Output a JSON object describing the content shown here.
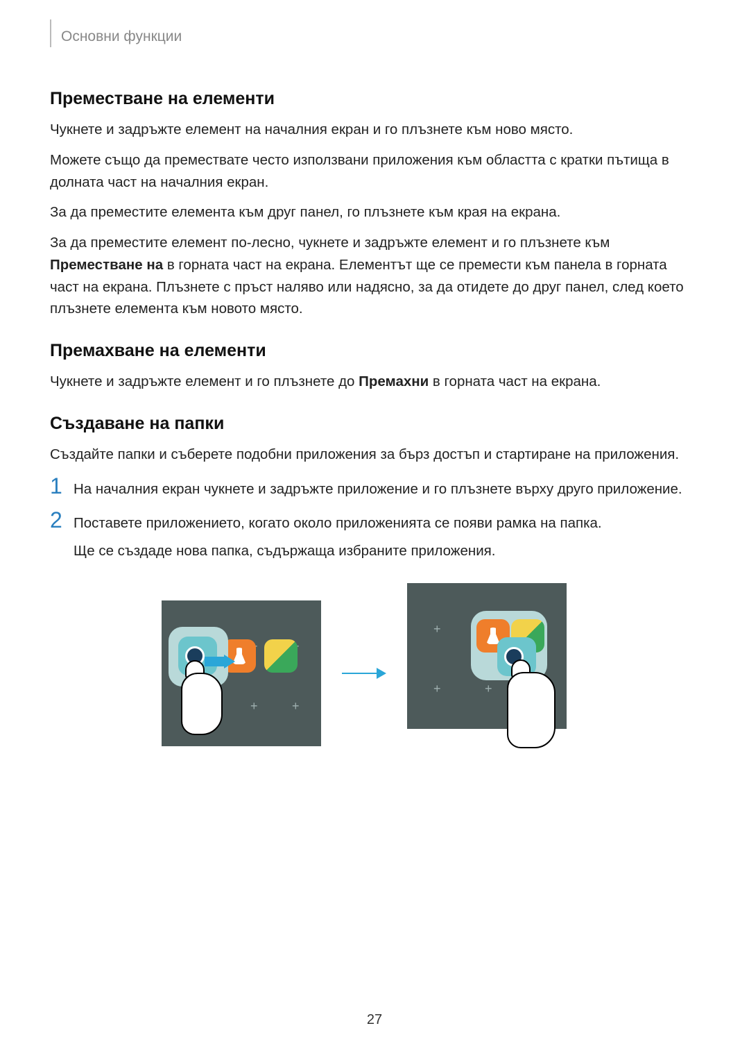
{
  "header": {
    "breadcrumb": "Основни функции"
  },
  "sections": {
    "move": {
      "title": "Преместване на елементи",
      "p1": "Чукнете и задръжте елемент на началния екран и го плъзнете към ново място.",
      "p2": "Можете също да премествате често използвани приложения към областта с кратки пътища в долната част на началния екран.",
      "p3": "За да преместите елемента към друг панел, го плъзнете към края на екрана.",
      "p4_pre": "За да преместите елемент по-лесно, чукнете и задръжте елемент и го плъзнете към ",
      "p4_bold": "Преместване на",
      "p4_post": " в горната част на екрана. Елементът ще се премести към панела в горната част на екрана. Плъзнете с пръст наляво или надясно, за да отидете до друг панел, след което плъзнете елемента към новото място."
    },
    "remove": {
      "title": "Премахване на елементи",
      "p1_pre": "Чукнете и задръжте елемент и го плъзнете до ",
      "p1_bold": "Премахни",
      "p1_post": " в горната част на екрана."
    },
    "folders": {
      "title": "Създаване на папки",
      "intro": "Създайте папки и съберете подобни приложения за бърз достъп и стартиране на приложения.",
      "step1_num": "1",
      "step1": "На началния екран чукнете и задръжте приложение и го плъзнете върху друго приложение.",
      "step2_num": "2",
      "step2": "Поставете приложението, когато около приложенията се появи рамка на папка.",
      "step2_sub": "Ще се създаде нова папка, съдържаща избраните приложения."
    }
  },
  "page_number": "27"
}
